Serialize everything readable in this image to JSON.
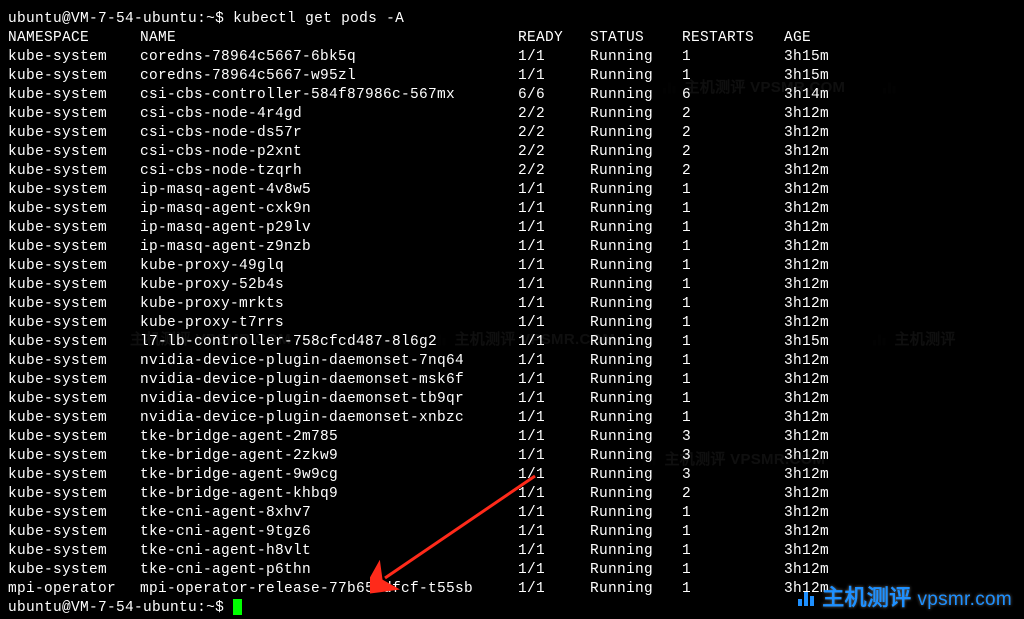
{
  "prompt": {
    "user": "ubuntu",
    "host": "VM-7-54-ubuntu",
    "path": "~",
    "symbol": "$",
    "command": "kubectl get pods -A"
  },
  "headers": {
    "namespace": "NAMESPACE",
    "name": "NAME",
    "ready": "READY",
    "status": "STATUS",
    "restarts": "RESTARTS",
    "age": "AGE"
  },
  "rows": [
    {
      "ns": "kube-system",
      "name": "coredns-78964c5667-6bk5q",
      "ready": "1/1",
      "status": "Running",
      "restarts": "1",
      "age": "3h15m"
    },
    {
      "ns": "kube-system",
      "name": "coredns-78964c5667-w95zl",
      "ready": "1/1",
      "status": "Running",
      "restarts": "1",
      "age": "3h15m"
    },
    {
      "ns": "kube-system",
      "name": "csi-cbs-controller-584f87986c-567mx",
      "ready": "6/6",
      "status": "Running",
      "restarts": "6",
      "age": "3h14m"
    },
    {
      "ns": "kube-system",
      "name": "csi-cbs-node-4r4gd",
      "ready": "2/2",
      "status": "Running",
      "restarts": "2",
      "age": "3h12m"
    },
    {
      "ns": "kube-system",
      "name": "csi-cbs-node-ds57r",
      "ready": "2/2",
      "status": "Running",
      "restarts": "2",
      "age": "3h12m"
    },
    {
      "ns": "kube-system",
      "name": "csi-cbs-node-p2xnt",
      "ready": "2/2",
      "status": "Running",
      "restarts": "2",
      "age": "3h12m"
    },
    {
      "ns": "kube-system",
      "name": "csi-cbs-node-tzqrh",
      "ready": "2/2",
      "status": "Running",
      "restarts": "2",
      "age": "3h12m"
    },
    {
      "ns": "kube-system",
      "name": "ip-masq-agent-4v8w5",
      "ready": "1/1",
      "status": "Running",
      "restarts": "1",
      "age": "3h12m"
    },
    {
      "ns": "kube-system",
      "name": "ip-masq-agent-cxk9n",
      "ready": "1/1",
      "status": "Running",
      "restarts": "1",
      "age": "3h12m"
    },
    {
      "ns": "kube-system",
      "name": "ip-masq-agent-p29lv",
      "ready": "1/1",
      "status": "Running",
      "restarts": "1",
      "age": "3h12m"
    },
    {
      "ns": "kube-system",
      "name": "ip-masq-agent-z9nzb",
      "ready": "1/1",
      "status": "Running",
      "restarts": "1",
      "age": "3h12m"
    },
    {
      "ns": "kube-system",
      "name": "kube-proxy-49glq",
      "ready": "1/1",
      "status": "Running",
      "restarts": "1",
      "age": "3h12m"
    },
    {
      "ns": "kube-system",
      "name": "kube-proxy-52b4s",
      "ready": "1/1",
      "status": "Running",
      "restarts": "1",
      "age": "3h12m"
    },
    {
      "ns": "kube-system",
      "name": "kube-proxy-mrkts",
      "ready": "1/1",
      "status": "Running",
      "restarts": "1",
      "age": "3h12m"
    },
    {
      "ns": "kube-system",
      "name": "kube-proxy-t7rrs",
      "ready": "1/1",
      "status": "Running",
      "restarts": "1",
      "age": "3h12m"
    },
    {
      "ns": "kube-system",
      "name": "l7-lb-controller-758cfcd487-8l6g2",
      "ready": "1/1",
      "status": "Running",
      "restarts": "1",
      "age": "3h15m"
    },
    {
      "ns": "kube-system",
      "name": "nvidia-device-plugin-daemonset-7nq64",
      "ready": "1/1",
      "status": "Running",
      "restarts": "1",
      "age": "3h12m"
    },
    {
      "ns": "kube-system",
      "name": "nvidia-device-plugin-daemonset-msk6f",
      "ready": "1/1",
      "status": "Running",
      "restarts": "1",
      "age": "3h12m"
    },
    {
      "ns": "kube-system",
      "name": "nvidia-device-plugin-daemonset-tb9qr",
      "ready": "1/1",
      "status": "Running",
      "restarts": "1",
      "age": "3h12m"
    },
    {
      "ns": "kube-system",
      "name": "nvidia-device-plugin-daemonset-xnbzc",
      "ready": "1/1",
      "status": "Running",
      "restarts": "1",
      "age": "3h12m"
    },
    {
      "ns": "kube-system",
      "name": "tke-bridge-agent-2m785",
      "ready": "1/1",
      "status": "Running",
      "restarts": "3",
      "age": "3h12m"
    },
    {
      "ns": "kube-system",
      "name": "tke-bridge-agent-2zkw9",
      "ready": "1/1",
      "status": "Running",
      "restarts": "3",
      "age": "3h12m"
    },
    {
      "ns": "kube-system",
      "name": "tke-bridge-agent-9w9cg",
      "ready": "1/1",
      "status": "Running",
      "restarts": "3",
      "age": "3h12m"
    },
    {
      "ns": "kube-system",
      "name": "tke-bridge-agent-khbq9",
      "ready": "1/1",
      "status": "Running",
      "restarts": "2",
      "age": "3h12m"
    },
    {
      "ns": "kube-system",
      "name": "tke-cni-agent-8xhv7",
      "ready": "1/1",
      "status": "Running",
      "restarts": "1",
      "age": "3h12m"
    },
    {
      "ns": "kube-system",
      "name": "tke-cni-agent-9tgz6",
      "ready": "1/1",
      "status": "Running",
      "restarts": "1",
      "age": "3h12m"
    },
    {
      "ns": "kube-system",
      "name": "tke-cni-agent-h8vlt",
      "ready": "1/1",
      "status": "Running",
      "restarts": "1",
      "age": "3h12m"
    },
    {
      "ns": "kube-system",
      "name": "tke-cni-agent-p6thn",
      "ready": "1/1",
      "status": "Running",
      "restarts": "1",
      "age": "3h12m"
    },
    {
      "ns": "mpi-operator",
      "name": "mpi-operator-release-77b65cdfcf-t55sb",
      "ready": "1/1",
      "status": "Running",
      "restarts": "1",
      "age": "3h12m"
    }
  ],
  "prompt2": {
    "user": "ubuntu",
    "host": "VM-7-54-ubuntu",
    "path": "~",
    "symbol": "$"
  },
  "watermark": {
    "text": "主机测评",
    "domain": "vpsmr.com",
    "ghost": "主机测评 VPSMR.COM"
  }
}
